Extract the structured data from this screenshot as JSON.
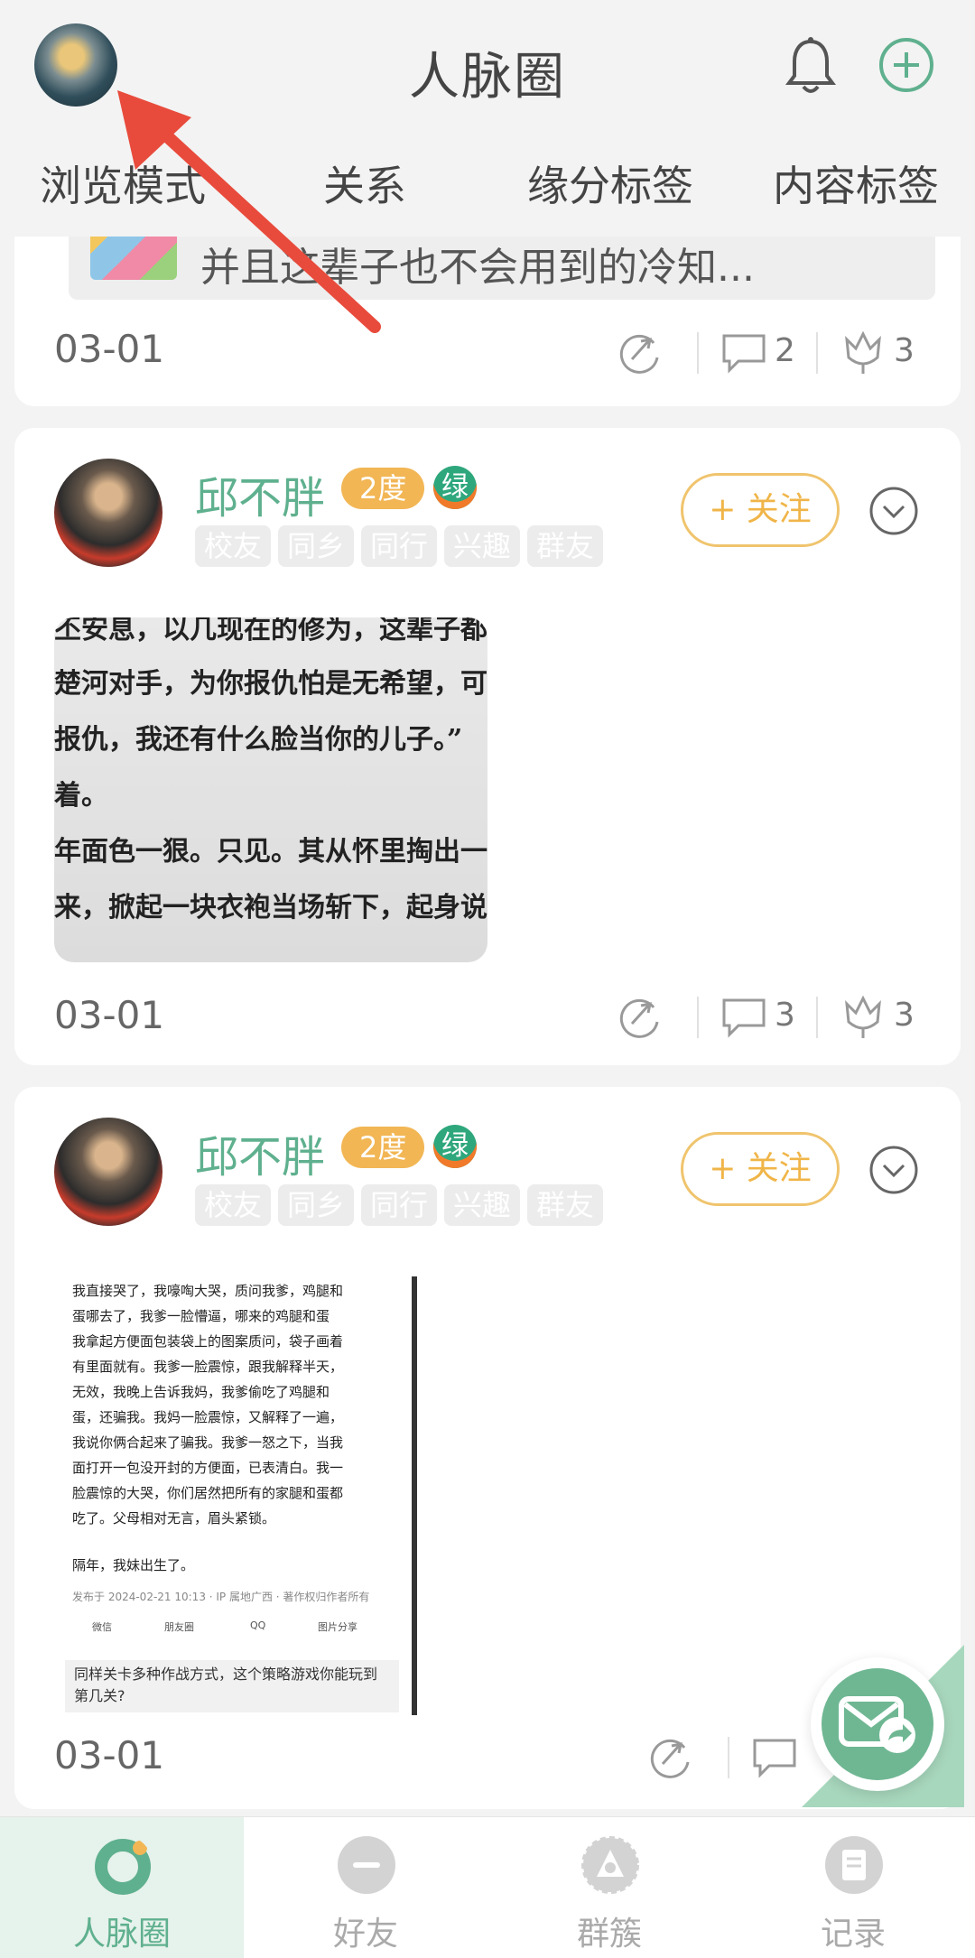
{
  "header": {
    "title": "人脉圈",
    "tabs": [
      "浏览模式",
      "关系",
      "缘分标签",
      "内容标签"
    ]
  },
  "colors": {
    "accent": "#5fb08e",
    "badge": "#f2b655",
    "follow": "#f0b548"
  },
  "post0": {
    "shared_text": "并且这辈子也不会用到的冷知...",
    "date": "03-01",
    "comments": "2",
    "likes": "3"
  },
  "post1": {
    "user": "邱不胖",
    "degree": "2度",
    "badge": "绿",
    "chips": [
      "校友",
      "同乡",
      "同行",
      "兴趣",
      "群友"
    ],
    "follow": "+ 关注",
    "image_lines": [
      "丕安息，以几现在的修为，这辈子都",
      "楚河对手，为你报仇怕是无希望，可不",
      "报仇，我还有什么脸当你的儿子。”",
      "着。",
      "年面色一狠。只见。其从怀里掏出一",
      "来，掀起一块衣袍当场斩下，起身说道"
    ],
    "date": "03-01",
    "comments": "3",
    "likes": "3"
  },
  "post2": {
    "user": "邱不胖",
    "degree": "2度",
    "badge": "绿",
    "chips": [
      "校友",
      "同乡",
      "同行",
      "兴趣",
      "群友"
    ],
    "follow": "+ 关注",
    "image_lines": [
      "我直接哭了，我嚎啕大哭，质问我爹，鸡腿和",
      "蛋哪去了，我爹一脸懵逼，哪来的鸡腿和蛋",
      "我拿起方便面包装袋上的图案质问，袋子画着",
      "有里面就有。我爹一脸震惊，跟我解释半天，",
      "无效，我晚上告诉我妈，我爹偷吃了鸡腿和",
      "蛋，还骗我。我妈一脸震惊，又解释了一遍，",
      "我说你俩合起来了骗我。我爹一怒之下，当我",
      "面打开一包没开封的方便面，已表清白。我一",
      "脸震惊的大哭，你们居然把所有的家腿和蛋都",
      "吃了。父母相对无言，眉头紧锁。",
      "",
      "隔年，我妹出生了。"
    ],
    "image_meta": "发布于 2024-02-21 10:13 · IP 属地广西 · 著作权归作者所有",
    "image_share": [
      "微信",
      "朋友圈",
      "QQ",
      "图片分享"
    ],
    "image_ad": "同样关卡多种作战方式，这个策略游戏你能玩到第几关?",
    "date": "03-01"
  },
  "bottom_nav": [
    {
      "label": "人脉圈",
      "icon": "circle-icon"
    },
    {
      "label": "好友",
      "icon": "friends-icon"
    },
    {
      "label": "群簇",
      "icon": "group-icon"
    },
    {
      "label": "记录",
      "icon": "record-icon"
    }
  ]
}
